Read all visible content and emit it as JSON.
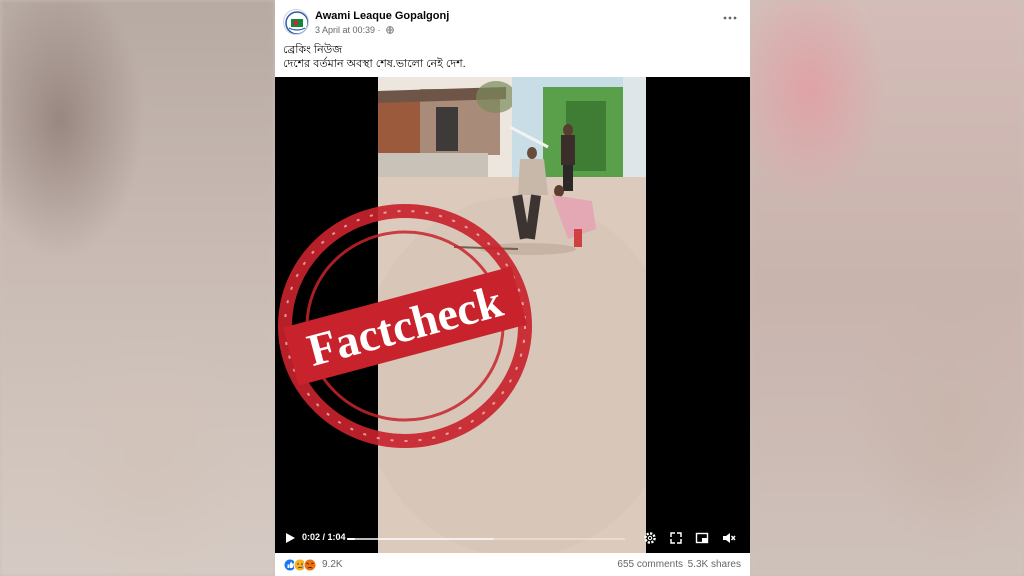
{
  "post": {
    "page_name": "Awami Leaque Gopalgonj",
    "timestamp": "3 April at 00:39",
    "separator": "·",
    "caption_line1": "ব্রেকিং নিউজ",
    "caption_line2": "দেশের বর্তমান অবস্থা শেষ.ভালো নেই দেশ."
  },
  "video": {
    "current_time": "0:02",
    "duration": "1:04",
    "time_separator": " / ",
    "progress": 0.03,
    "buffered": 0.53,
    "controls": [
      "play-icon",
      "settings-icon",
      "fullscreen-icon",
      "picture-in-picture-icon",
      "mute-icon"
    ]
  },
  "overlay": {
    "stamp_text": "Factcheck",
    "stamp_color": "#c8232c"
  },
  "footer": {
    "reaction_count": "9.2K",
    "comments": "655 comments",
    "shares": "5.3K shares",
    "reactions": [
      "like-icon",
      "sad-icon",
      "angry-icon"
    ]
  },
  "colors": {
    "like": "#1877f2",
    "sad": "#f7b125",
    "angry": "#e9710f"
  }
}
